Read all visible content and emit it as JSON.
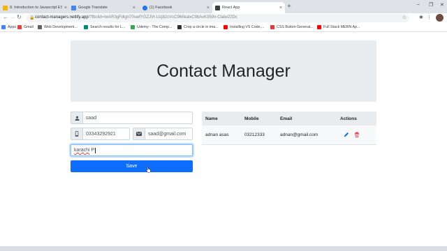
{
  "browser": {
    "tabs": [
      {
        "title": "8. Introduction to Javascript ES6",
        "close": "×",
        "favicon_color": "#f4b400",
        "active": false
      },
      {
        "title": "Google Translate",
        "close": "×",
        "favicon_color": "#4285f4",
        "active": false
      },
      {
        "title": "(1) Facebook",
        "close": "×",
        "favicon_color": "#1877f2",
        "active": false
      },
      {
        "title": "React App",
        "close": "×",
        "favicon_color": "#3c4043",
        "active": true
      }
    ],
    "new_tab": "+",
    "window_controls": {
      "minimize": "–",
      "maximize": "❐",
      "close": "✕"
    },
    "nav": {
      "back": "←",
      "forward": "→",
      "reload": "↻"
    },
    "lock": "🔒",
    "url": {
      "host": "contact-managers.netlify.app",
      "path": "/?fbclid=IwAR3gFdlgn70swfYGZJVr-Uzj82cVcC968kalxC9bAvK359x-Claiw22Dc"
    },
    "star": "☆",
    "toolbar_icons": {
      "extensions": "✱",
      "menu": "⋮"
    },
    "bookmarks": [
      {
        "label": "Apps",
        "color": "#4285f4"
      },
      {
        "label": "Gmail",
        "color": "#ea4335"
      },
      {
        "label": "Web Development...",
        "color": "#5f6368"
      },
      {
        "label": "Search results for L...",
        "color": "#00897b"
      },
      {
        "label": "Udemy - The Comp...",
        "color": "#34a853"
      },
      {
        "label": "Crop a circle in ima...",
        "color": "#263238"
      },
      {
        "label": "Installing VS Code,...",
        "color": "#ff0000"
      },
      {
        "label": "CSS Button Generat...",
        "color": "#e53935"
      },
      {
        "label": "Full Stack MERN Ap...",
        "color": "#ff0000"
      }
    ]
  },
  "app": {
    "title": "Contact Manager",
    "form": {
      "name_value": "saad",
      "mobile_value": "03343292921",
      "email_value": "saad@gmail.com",
      "address_typed": "karachi",
      "address_rest": " P",
      "save_label": "Save"
    },
    "table": {
      "headers": [
        "Name",
        "Mobile",
        "Email",
        "Actions"
      ],
      "rows": [
        {
          "name": "adnan asas",
          "mobile": "03212333",
          "email": "adnan@gmail.com"
        }
      ]
    },
    "colors": {
      "primary": "#0d6efd",
      "edit": "#0d6efd",
      "delete": "#dc3545",
      "jumbotron": "#e9ecef"
    }
  }
}
